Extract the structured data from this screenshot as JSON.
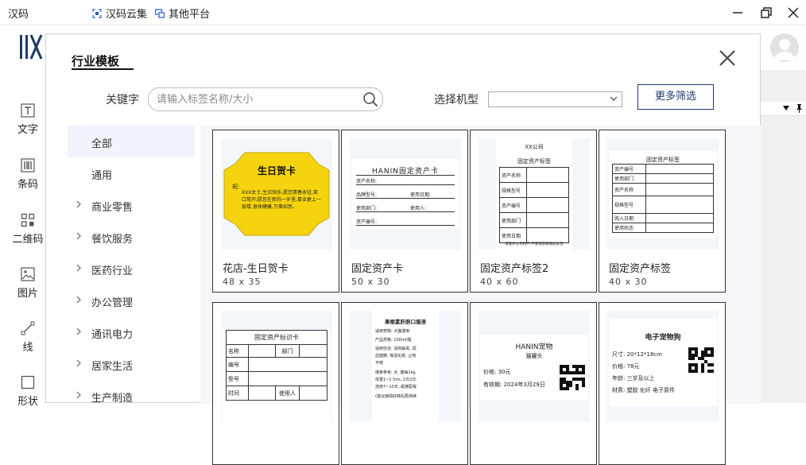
{
  "titlebar": {
    "app_title": "汉码",
    "links": [
      {
        "label": "汉码云集",
        "icon": "scan-icon"
      },
      {
        "label": "其他平台",
        "icon": "platform-icon"
      }
    ]
  },
  "left_tools": [
    {
      "label": "文字",
      "icon": "text-icon"
    },
    {
      "label": "条码",
      "icon": "barcode-icon"
    },
    {
      "label": "二维码",
      "icon": "qrcode-icon"
    },
    {
      "label": "图片",
      "icon": "image-icon"
    },
    {
      "label": "线",
      "icon": "line-icon"
    },
    {
      "label": "形状",
      "icon": "shape-icon"
    }
  ],
  "dialog": {
    "title": "行业模板",
    "keyword_label": "关键字",
    "keyword_placeholder": "请输入标签名称/大小",
    "keyword_value": "",
    "model_label": "选择机型",
    "model_value": "",
    "more_filter_label": "更多筛选",
    "categories": [
      {
        "label": "全部",
        "active": true,
        "expandable": false
      },
      {
        "label": "通用",
        "active": false,
        "expandable": false
      },
      {
        "label": "商业零售",
        "active": false,
        "expandable": true
      },
      {
        "label": "餐饮服务",
        "active": false,
        "expandable": true
      },
      {
        "label": "医药行业",
        "active": false,
        "expandable": true
      },
      {
        "label": "办公管理",
        "active": false,
        "expandable": true
      },
      {
        "label": "通讯电力",
        "active": false,
        "expandable": true
      },
      {
        "label": "居家生活",
        "active": false,
        "expandable": true
      },
      {
        "label": "生产制造",
        "active": false,
        "expandable": true
      }
    ],
    "templates": [
      {
        "name": "花店-生日贺卡",
        "size": "48 x 35"
      },
      {
        "name": "固定资产卡",
        "size": "50 x 30"
      },
      {
        "name": "固定资产标签2",
        "size": "40 x 60"
      },
      {
        "name": "固定资产标签",
        "size": "40 x 30"
      },
      {
        "name": "",
        "size": ""
      },
      {
        "name": "",
        "size": ""
      },
      {
        "name": "",
        "size": ""
      },
      {
        "name": "",
        "size": ""
      }
    ],
    "previews": {
      "birthday": {
        "title": "生日贺卡",
        "greeting": "祝:",
        "body": "XXX女士,生日快乐,愿您青春永驻,笑口常开;愿您在新的一岁里,事业更上一层楼,身体健康,万事如意。"
      },
      "asset_card": {
        "title": "HANIN固定资产卡",
        "fields": [
          "资产名称:",
          "品牌型号:",
          "使用日期:",
          "使用部门:",
          "使用人:",
          "资产编号:"
        ]
      },
      "asset_label2": {
        "company": "XX公司",
        "title": "固定资产标签",
        "rows": [
          "资产名称",
          "规格型号",
          "资产编号",
          "使用部门",
          "使用日期"
        ],
        "footer": "请爱护公司财产,不要随意撕毁此标签"
      },
      "asset_label": {
        "title": "固定资产标签",
        "rows": [
          "资产编号",
          "使用部门",
          "资产名称",
          "规格型号",
          "购入日期",
          "使用状态"
        ]
      },
      "asset_id_card": {
        "title": "固定资产标识卡",
        "row1": [
          "名称",
          "部门"
        ],
        "rows": [
          "编号",
          "型号"
        ],
        "row_last": [
          "时间",
          "使用人"
        ]
      },
      "feed": {
        "title": "果根素肝胆口服液",
        "lines": [
          "适用宠物: 犬猫通用",
          "产品规格: 100ml/瓶",
          "适用性状: 清热解毒, 调",
          "血健脾, 保湿化痰, 止咳",
          "平喘",
          "喂食参考: 犬, 猫每1kg",
          "体重1~1.5ml, 1日2次,",
          "连用7~10天, 或遵医嘱",
          "(建议病情好转后再持续"
        ]
      },
      "can": {
        "title": "HANIN宠物",
        "subtitle": "猫罐头",
        "price": "价格: 30元",
        "expiry": "有效期: 2024年3月29日"
      },
      "toy": {
        "title": "电子宠物狗",
        "size": "尺寸: 20*12*18cm",
        "price": "价格: 78元",
        "age": "年龄: 三岁及以上",
        "material": "材质: 塑胶 化纤 电子原件"
      }
    }
  },
  "colors": {
    "accent": "#1b3a6b",
    "active_category_bg": "#f0f4fa",
    "card_gold": "#f5d40f"
  }
}
